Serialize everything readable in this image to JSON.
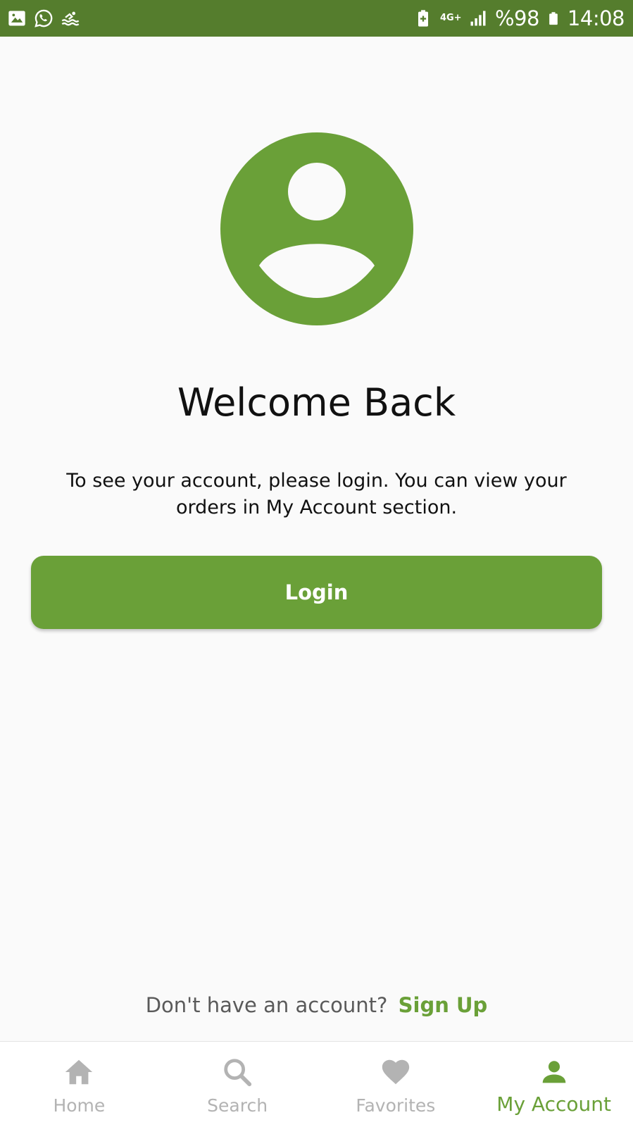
{
  "status_bar": {
    "network": "4G+",
    "battery": "%98",
    "time": "14:08",
    "left_icons": [
      "gallery-icon",
      "whatsapp-icon",
      "pool-icon"
    ],
    "right_icons": [
      "battery-saver-icon",
      "network-icon",
      "signal-icon",
      "battery-icon"
    ]
  },
  "profile": {
    "icon": "account-circle-icon"
  },
  "welcome": {
    "title": "Welcome Back",
    "message": "To see your account, please login. You can view your orders in My Account section."
  },
  "login": {
    "label": "Login"
  },
  "signup": {
    "prompt": "Don't have an account?",
    "link": "Sign Up"
  },
  "bottom_nav": {
    "items": [
      {
        "label": "Home",
        "icon": "home-icon",
        "active": false
      },
      {
        "label": "Search",
        "icon": "search-icon",
        "active": false
      },
      {
        "label": "Favorites",
        "icon": "heart-icon",
        "active": false
      },
      {
        "label": "My Account",
        "icon": "person-icon",
        "active": true
      }
    ]
  },
  "colors": {
    "accent": "#6aa038",
    "status_bar": "#557d2d",
    "inactive": "#b3b3b3",
    "background": "#fafafa"
  }
}
